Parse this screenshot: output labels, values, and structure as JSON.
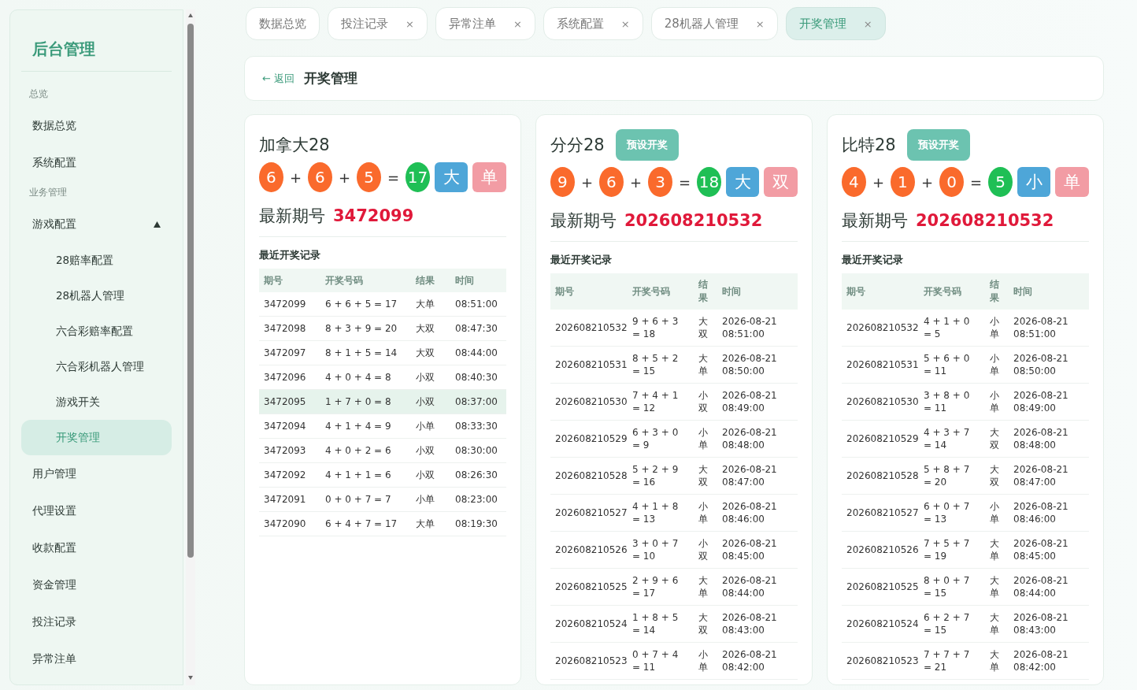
{
  "sidebar": {
    "title": "后台管理",
    "sections": [
      {
        "label": "总览",
        "items": [
          {
            "label": "数据总览",
            "selected": false
          },
          {
            "label": "系统配置",
            "selected": false
          }
        ]
      },
      {
        "label": "业务管理",
        "items": [
          {
            "label": "游戏配置",
            "selected": false,
            "expanded": true,
            "children": [
              {
                "label": "28赔率配置",
                "selected": false
              },
              {
                "label": "28机器人管理",
                "selected": false
              },
              {
                "label": "六合彩赔率配置",
                "selected": false
              },
              {
                "label": "六合彩机器人管理",
                "selected": false
              },
              {
                "label": "游戏开关",
                "selected": false
              },
              {
                "label": "开奖管理",
                "selected": true
              }
            ]
          },
          {
            "label": "用户管理",
            "selected": false
          },
          {
            "label": "代理设置",
            "selected": false
          },
          {
            "label": "收款配置",
            "selected": false
          },
          {
            "label": "资金管理",
            "selected": false
          },
          {
            "label": "投注记录",
            "selected": false
          },
          {
            "label": "异常注单",
            "selected": false
          }
        ]
      }
    ]
  },
  "tabs": [
    {
      "label": "数据总览",
      "selected": false,
      "closable": false
    },
    {
      "label": "投注记录",
      "selected": false,
      "closable": true,
      "close": "×"
    },
    {
      "label": "异常注单",
      "selected": false,
      "closable": true,
      "close": "×"
    },
    {
      "label": "系统配置",
      "selected": false,
      "closable": true,
      "close": "×"
    },
    {
      "label": "28机器人管理",
      "selected": false,
      "closable": true,
      "close": "×"
    },
    {
      "label": "开奖管理",
      "selected": true,
      "closable": true,
      "close": "×"
    }
  ],
  "header": {
    "back": "← 返回",
    "title": "开奖管理"
  },
  "cards": [
    {
      "title": "加拿大28",
      "draw": {
        "balls": [
          {
            "kind": "digit",
            "value": "6"
          },
          {
            "kind": "op",
            "value": "+"
          },
          {
            "kind": "digit",
            "value": "6"
          },
          {
            "kind": "op",
            "value": "+"
          },
          {
            "kind": "digit",
            "value": "5"
          },
          {
            "kind": "op",
            "value": "="
          },
          {
            "kind": "sum",
            "value": "17"
          }
        ],
        "tags": [
          {
            "kind": "size",
            "text": "大"
          },
          {
            "kind": "parity",
            "text": "单"
          }
        ]
      },
      "latest_label": "最新期号",
      "latest_value": "3472099",
      "records_title": "最近开奖记录",
      "columns": [
        "期号",
        "开奖号码",
        "结果",
        "时间"
      ],
      "rows": [
        {
          "period": "3472099",
          "numbers": "6 + 6 + 5 = 17",
          "result": "大单",
          "time": "08:51:00",
          "highlighted": false
        },
        {
          "period": "3472098",
          "numbers": "8 + 3 + 9 = 20",
          "result": "大双",
          "time": "08:47:30",
          "highlighted": false
        },
        {
          "period": "3472097",
          "numbers": "8 + 1 + 5 = 14",
          "result": "大双",
          "time": "08:44:00",
          "highlighted": false
        },
        {
          "period": "3472096",
          "numbers": "4 + 0 + 4 = 8",
          "result": "小双",
          "time": "08:40:30",
          "highlighted": false
        },
        {
          "period": "3472095",
          "numbers": "1 + 7 + 0 = 8",
          "result": "小双",
          "time": "08:37:00",
          "highlighted": true
        },
        {
          "period": "3472094",
          "numbers": "4 + 1 + 4 = 9",
          "result": "小单",
          "time": "08:33:30",
          "highlighted": false
        },
        {
          "period": "3472093",
          "numbers": "4 + 0 + 2 = 6",
          "result": "小双",
          "time": "08:30:00",
          "highlighted": false
        },
        {
          "period": "3472092",
          "numbers": "4 + 1 + 1 = 6",
          "result": "小双",
          "time": "08:26:30",
          "highlighted": false
        },
        {
          "period": "3472091",
          "numbers": "0 + 0 + 7 = 7",
          "result": "小单",
          "time": "08:23:00",
          "highlighted": false
        },
        {
          "period": "3472090",
          "numbers": "6 + 4 + 7 = 17",
          "result": "大单",
          "time": "08:19:30",
          "highlighted": false
        }
      ]
    },
    {
      "title": "分分28",
      "preset_button": "预设开奖",
      "draw": {
        "balls": [
          {
            "kind": "digit",
            "value": "9"
          },
          {
            "kind": "op",
            "value": "+"
          },
          {
            "kind": "digit",
            "value": "6"
          },
          {
            "kind": "op",
            "value": "+"
          },
          {
            "kind": "digit",
            "value": "3"
          },
          {
            "kind": "op",
            "value": "="
          },
          {
            "kind": "sum",
            "value": "18"
          }
        ],
        "tags": [
          {
            "kind": "size",
            "text": "大"
          },
          {
            "kind": "parity",
            "text": "双"
          }
        ]
      },
      "latest_label": "最新期号",
      "latest_value": "202608210532",
      "records_title": "最近开奖记录",
      "columns": [
        "期号",
        "开奖号码",
        "结果",
        "时间"
      ],
      "rows": [
        {
          "period": "202608210532",
          "numbers": "9 + 6 + 3 = 18",
          "result": "大双",
          "time": "2026-08-21 08:51:00"
        },
        {
          "period": "202608210531",
          "numbers": "8 + 5 + 2 = 15",
          "result": "大单",
          "time": "2026-08-21 08:50:00"
        },
        {
          "period": "202608210530",
          "numbers": "7 + 4 + 1 = 12",
          "result": "小双",
          "time": "2026-08-21 08:49:00"
        },
        {
          "period": "202608210529",
          "numbers": "6 + 3 + 0 = 9",
          "result": "小单",
          "time": "2026-08-21 08:48:00"
        },
        {
          "period": "202608210528",
          "numbers": "5 + 2 + 9 = 16",
          "result": "大双",
          "time": "2026-08-21 08:47:00"
        },
        {
          "period": "202608210527",
          "numbers": "4 + 1 + 8 = 13",
          "result": "小单",
          "time": "2026-08-21 08:46:00"
        },
        {
          "period": "202608210526",
          "numbers": "3 + 0 + 7 = 10",
          "result": "小双",
          "time": "2026-08-21 08:45:00"
        },
        {
          "period": "202608210525",
          "numbers": "2 + 9 + 6 = 17",
          "result": "大单",
          "time": "2026-08-21 08:44:00"
        },
        {
          "period": "202608210524",
          "numbers": "1 + 8 + 5 = 14",
          "result": "大双",
          "time": "2026-08-21 08:43:00"
        },
        {
          "period": "202608210523",
          "numbers": "0 + 7 + 4 = 11",
          "result": "小单",
          "time": "2026-08-21 08:42:00"
        }
      ]
    },
    {
      "title": "比特28",
      "preset_button": "预设开奖",
      "draw": {
        "balls": [
          {
            "kind": "digit",
            "value": "4"
          },
          {
            "kind": "op",
            "value": "+"
          },
          {
            "kind": "digit",
            "value": "1"
          },
          {
            "kind": "op",
            "value": "+"
          },
          {
            "kind": "digit",
            "value": "0"
          },
          {
            "kind": "op",
            "value": "="
          },
          {
            "kind": "sum",
            "value": "5"
          }
        ],
        "tags": [
          {
            "kind": "size",
            "text": "小"
          },
          {
            "kind": "parity",
            "text": "单"
          }
        ]
      },
      "latest_label": "最新期号",
      "latest_value": "202608210532",
      "records_title": "最近开奖记录",
      "columns": [
        "期号",
        "开奖号码",
        "结果",
        "时间"
      ],
      "rows": [
        {
          "period": "202608210532",
          "numbers": "4 + 1 + 0 = 5",
          "result": "小单",
          "time": "2026-08-21 08:51:00"
        },
        {
          "period": "202608210531",
          "numbers": "5 + 6 + 0 = 11",
          "result": "小单",
          "time": "2026-08-21 08:50:00"
        },
        {
          "period": "202608210530",
          "numbers": "3 + 8 + 0 = 11",
          "result": "小单",
          "time": "2026-08-21 08:49:00"
        },
        {
          "period": "202608210529",
          "numbers": "4 + 3 + 7 = 14",
          "result": "大双",
          "time": "2026-08-21 08:48:00"
        },
        {
          "period": "202608210528",
          "numbers": "5 + 8 + 7 = 20",
          "result": "大双",
          "time": "2026-08-21 08:47:00"
        },
        {
          "period": "202608210527",
          "numbers": "6 + 0 + 7 = 13",
          "result": "小单",
          "time": "2026-08-21 08:46:00"
        },
        {
          "period": "202608210526",
          "numbers": "7 + 5 + 7 = 19",
          "result": "大单",
          "time": "2026-08-21 08:45:00"
        },
        {
          "period": "202608210525",
          "numbers": "8 + 0 + 7 = 15",
          "result": "大单",
          "time": "2026-08-21 08:44:00"
        },
        {
          "period": "202608210524",
          "numbers": "6 + 2 + 7 = 15",
          "result": "大单",
          "time": "2026-08-21 08:43:00"
        },
        {
          "period": "202608210523",
          "numbers": "7 + 7 + 7 = 21",
          "result": "大单",
          "time": "2026-08-21 08:42:00"
        }
      ]
    }
  ]
}
